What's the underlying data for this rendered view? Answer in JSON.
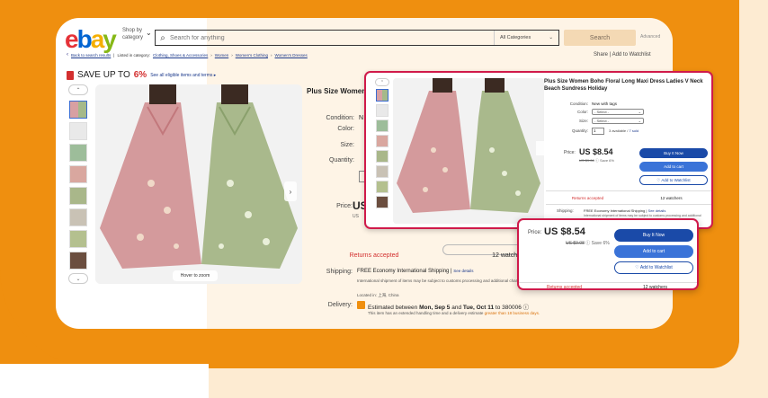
{
  "colors": {
    "accent_orange": "#ef8f0f",
    "cream": "#fdebd2",
    "highlight_red": "#d01a4a",
    "ebay_blue": "#1a4aa8"
  },
  "header": {
    "logo": {
      "e": "e",
      "b": "b",
      "a": "a",
      "y": "y"
    },
    "shop_by_line1": "Shop by",
    "shop_by_line2": "category",
    "search_placeholder": "Search for anything",
    "category_select": "All Categories",
    "search_button": "Search",
    "advanced": "Advanced"
  },
  "breadcrumb": {
    "back": "Back to search results",
    "listed_in": "Listed in category:",
    "items": [
      "Clothing, Shoes & Accessories",
      "Women",
      "Women's Clothing",
      "Women's Dresses"
    ],
    "share": "Share",
    "add_watchlist": "Add to Watchlist"
  },
  "banner": {
    "prefix": "SAVE UP TO",
    "percent": "6%",
    "link": "See all eligible items and terms"
  },
  "product": {
    "title_truncated": "Plus Size Women Boho Floral Long Maxi Dress Ladies V Neck Beach Sundress Holiday",
    "condition_label": "Condition:",
    "condition_value": "N",
    "color_label": "Color:",
    "size_label": "Size:",
    "quantity_label": "Quantity:",
    "price_label": "Price:",
    "price_value": "US",
    "price_old": "US",
    "hover_zoom": "Hover to zoom",
    "returns": "Returns accepted",
    "watchers": "12 watchers",
    "shipping_label": "Shipping:",
    "shipping_value": "FREE Economy International Shipping",
    "see_details": "See details",
    "shipping_note": "International shipment of items may be subject to customs processing and additional charges.",
    "located": "Located in: 上海, China",
    "delivery_label": "Delivery:",
    "delivery_prefix": "Estimated between",
    "delivery_start": "Mon, Sep 5",
    "delivery_and": "and",
    "delivery_end": "Tue, Oct 11",
    "delivery_suffix": "to 380006",
    "delivery_note_a": "This item has an extended handling time and a delivery estimate",
    "delivery_note_hl": "greater than 18 business days."
  },
  "zoom_panel": {
    "title": "Plus Size Women Boho Floral Long Maxi Dress Ladies V Neck Beach Sundress Holiday",
    "condition_label": "Condition:",
    "condition_value": "New with tags",
    "color_label": "Color:",
    "color_select": "- Select -",
    "size_label": "Size:",
    "size_select": "- Select -",
    "quantity_label": "Quantity:",
    "quantity_value": "1",
    "available_text": "3 available /",
    "sold_link": "7 sold",
    "price_label": "Price:",
    "price_value": "US $8.54",
    "price_old": "US $9.08",
    "save_pct": "Save 6%",
    "buy_now": "Buy It Now",
    "add_cart": "Add to cart",
    "add_watch": "♡ Add to Watchlist",
    "returns": "Returns accepted",
    "watchers": "12 watchers",
    "shipping_label": "Shipping:",
    "shipping_value": "FREE Economy International Shipping",
    "see_details": "See details",
    "shipping_note": "International shipment of items may be subject to customs processing and additional"
  },
  "price_panel": {
    "price_label": "Price:",
    "price_value": "US $8.54",
    "price_old": "US $9.08",
    "save_pct": "Save 6%",
    "buy_now": "Buy It Now",
    "add_cart": "Add to cart",
    "add_watch": "♡ Add to Watchlist",
    "returns": "Returns accepted",
    "watchers": "12 watchers"
  }
}
